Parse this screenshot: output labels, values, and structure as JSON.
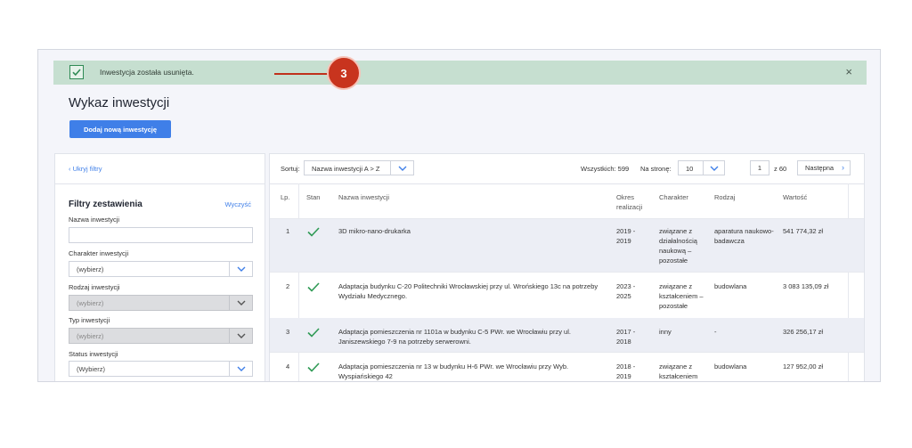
{
  "alert": {
    "message": "Inwestycja została usunięta.",
    "close_glyph": "×",
    "icon": "check-square-icon",
    "color": "#c6dfd0"
  },
  "annotation": {
    "badge": "3",
    "color": "#c8341e"
  },
  "page": {
    "title": "Wykaz inwestycji",
    "add_button": "Dodaj nową inwestycję",
    "accent": "#3f7fe8"
  },
  "filters": {
    "hide_link": "Ukryj filtry",
    "title": "Filtry zestawienia",
    "clear": "Wyczyść",
    "fields": [
      {
        "label": "Nazwa inwestycji",
        "type": "text",
        "value": ""
      },
      {
        "label": "Charakter inwestycji",
        "type": "select",
        "value": "(wybierz)",
        "disabled": false
      },
      {
        "label": "Rodzaj inwestycji",
        "type": "select",
        "value": "(wybierz)",
        "disabled": true
      },
      {
        "label": "Typ inwestycji",
        "type": "select",
        "value": "(wybierz)",
        "disabled": true
      },
      {
        "label": "Status inwestycji",
        "type": "select",
        "value": "(Wybierz)",
        "disabled": false
      }
    ]
  },
  "toolbar": {
    "sort_label": "Sortuj:",
    "sort_value": "Nazwa inwestycji A > Z",
    "total": "Wszystkich: 599",
    "per_page_label": "Na stronę:",
    "per_page_value": "10",
    "current_page": "1",
    "of_pages": "z  60",
    "next": "Następna"
  },
  "table": {
    "headers": {
      "lp": "Lp.",
      "state": "Stan",
      "name": "Nazwa inwestycji",
      "period": "Okres realizacji",
      "character": "Charakter",
      "kind": "Rodzaj",
      "value": "Wartość"
    },
    "rows": [
      {
        "lp": "1",
        "state": "check-icon",
        "name": "3D mikro-nano-drukarka",
        "period": "2019 - 2019",
        "character": "związane z działalnością naukową – pozostałe",
        "kind": "aparatura naukowo-badawcza",
        "value": "541 774,32 zł"
      },
      {
        "lp": "2",
        "state": "check-icon",
        "name": "Adaptacja budynku C-20 Politechniki Wrocławskiej przy ul. Wrońskiego 13c na potrzeby Wydziału Medycznego.",
        "period": "2023 - 2025",
        "character": "związane z kształceniem – pozostałe",
        "kind": "budowlana",
        "value": "3 083 135,09 zł"
      },
      {
        "lp": "3",
        "state": "check-icon",
        "name": "Adaptacja pomieszczenia nr 1101a w budynku C-5 PWr. we Wrocławiu przy ul. Janiszewskiego 7-9 na potrzeby serwerowni.",
        "period": "2017 - 2018",
        "character": "inny",
        "kind": "-",
        "value": "326 256,17 zł"
      },
      {
        "lp": "4",
        "state": "check-icon",
        "name": "Adaptacja pomieszczenia nr 13 w budynku H-6 PWr. we Wrocławiu przy Wyb. Wyspiańskiego 42",
        "period": "2018 - 2019",
        "character": "związane z kształceniem",
        "kind": "budowlana",
        "value": "127 952,00 zł"
      }
    ]
  }
}
